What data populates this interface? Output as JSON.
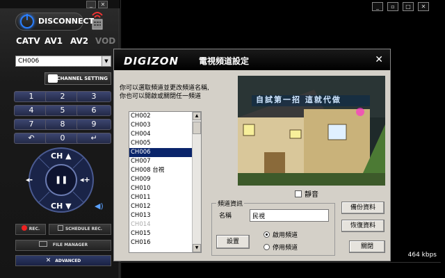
{
  "remote": {
    "disconnect_label": "DISCONNECT",
    "sources": [
      "CATV",
      "AV1",
      "AV2",
      "VOD"
    ],
    "channel_select_value": "CH006",
    "channel_setting_label": "CHANNEL SETTING",
    "keys": [
      "1",
      "2",
      "3",
      "4",
      "5",
      "6",
      "7",
      "8",
      "9",
      "↶",
      "0",
      "↵"
    ],
    "pad": {
      "ch_up": "CH ▲",
      "ch_down": "CH ▼",
      "vol_down": "◂-",
      "vol_up": "◂+",
      "play_pause": "❚❚"
    },
    "rec_label": "REC.",
    "schedule_label": "SCHEDULE REC.",
    "file_manager_label": "FILE   MANAGER",
    "advanced_label": "ADVANCED"
  },
  "dialog": {
    "logo": "DIGIZON",
    "title": "電視頻道設定",
    "instructions_line1": "你可以選取頻道並更改頻道名稱,",
    "instructions_line2": "你也可以開啟或關閉任一頻道",
    "channels": [
      {
        "label": "CH002"
      },
      {
        "label": "CH003"
      },
      {
        "label": "CH004"
      },
      {
        "label": "CH005"
      },
      {
        "label": "CH006",
        "selected": true
      },
      {
        "label": "CH007"
      },
      {
        "label": "CH008 台視"
      },
      {
        "label": "CH009"
      },
      {
        "label": "CH010"
      },
      {
        "label": "CH011"
      },
      {
        "label": "CH012"
      },
      {
        "label": "CH013"
      },
      {
        "label": "CH014",
        "disabled": true
      },
      {
        "label": "CH015"
      },
      {
        "label": "CH016"
      }
    ],
    "preview_caption": "自試第一招 這就代做",
    "mute_label": "靜音",
    "group_label": "頻道資訊",
    "name_label": "名稱",
    "name_value": "民視",
    "set_button": "設置",
    "enable_label": "啟用頻道",
    "disable_label": "停用頻道",
    "backup_button": "備份資料",
    "restore_button": "恢復資料",
    "close_button": "關閉"
  },
  "status": {
    "bitrate": "464 kbps"
  },
  "colors": {
    "accent_blue": "#2a7fff",
    "selection": "#0a246a",
    "key_fill": "#2e3760"
  }
}
